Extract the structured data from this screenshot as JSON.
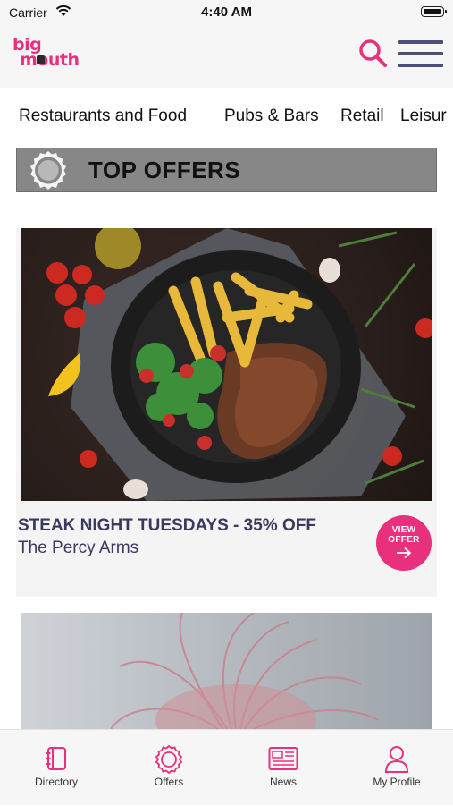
{
  "status": {
    "carrier": "Carrier",
    "time": "4:40 AM"
  },
  "header": {
    "logo_line1": "big",
    "logo_line2": "mouth"
  },
  "categories": [
    "Restaurants and Food",
    "Pubs & Bars",
    "Retail",
    "Leisur"
  ],
  "section": {
    "title": "TOP OFFERS"
  },
  "offers": [
    {
      "title": "STEAK NIGHT TUESDAYS - 35% OFF",
      "venue": "The Percy Arms",
      "button_line1": "VIEW",
      "button_line2": "OFFER"
    }
  ],
  "tabs": [
    {
      "label": "Directory",
      "icon": "book-icon"
    },
    {
      "label": "Offers",
      "icon": "badge-icon"
    },
    {
      "label": "News",
      "icon": "newspaper-icon"
    },
    {
      "label": "My Profile",
      "icon": "person-icon"
    }
  ],
  "colors": {
    "accent": "#e8307c",
    "dark_text": "#3a3a5e",
    "menu": "#4e4e7a",
    "banner": "#878787"
  }
}
